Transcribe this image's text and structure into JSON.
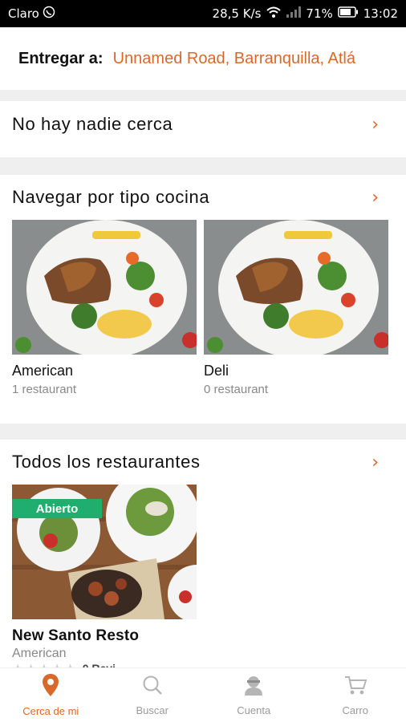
{
  "status_bar": {
    "carrier": "Claro",
    "speed": "28,5 K/s",
    "battery": "71%",
    "time": "13:02",
    "icons": [
      "whatsapp-icon",
      "wifi-icon",
      "signal-icon",
      "battery-icon"
    ]
  },
  "delivery": {
    "label": "Entregar a:",
    "address": "Unnamed Road, Barranquilla, Atlá"
  },
  "sections": {
    "nearby": {
      "title": "No hay nadie cerca",
      "chevron": "›"
    },
    "cuisine": {
      "title": "Navegar por tipo cocina",
      "chevron": "›",
      "items": [
        {
          "name": "American",
          "count": "1 restaurant"
        },
        {
          "name": "Deli",
          "count": "0 restaurant"
        }
      ]
    },
    "all": {
      "title": "Todos los restaurantes",
      "chevron": "›",
      "items": [
        {
          "badge": "Abierto",
          "name": "New Santo Resto",
          "cuisine": "American",
          "stars": "★★★★★",
          "reviews": "0 Revi"
        }
      ]
    }
  },
  "bottom_nav": {
    "items": [
      {
        "label": "Cerca de mi",
        "icon": "location-pin-icon",
        "active": true
      },
      {
        "label": "Buscar",
        "icon": "search-icon",
        "active": false
      },
      {
        "label": "Cuenta",
        "icon": "user-icon",
        "active": false
      },
      {
        "label": "Carro",
        "icon": "cart-icon",
        "active": false
      }
    ]
  },
  "colors": {
    "accent": "#d8692a",
    "open_badge": "#1fae6d",
    "background": "#efefef"
  }
}
